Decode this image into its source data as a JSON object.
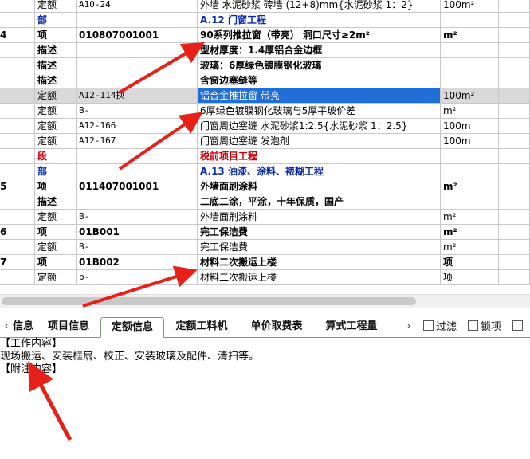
{
  "grid": {
    "rows": [
      {
        "no": "",
        "type": "定额",
        "code": "A10-24",
        "name": "外墙 水泥砂浆 砖墙 (12+8)mm{水泥砂浆 1：2}",
        "unit": "100m²",
        "style": "normal"
      },
      {
        "no": "",
        "type": "部",
        "code": "",
        "name": "A.12 门窗工程",
        "unit": "",
        "style": "blue"
      },
      {
        "no": "4",
        "type": "项",
        "code": "010807001001",
        "name": "90系列推拉窗（带亮） 洞口尺寸≥2m²",
        "unit": "m²",
        "style": "item"
      },
      {
        "no": "",
        "type": "描述",
        "code": "",
        "name": "型材厚度：1.4厚铝合金边框",
        "unit": "",
        "style": "desc"
      },
      {
        "no": "",
        "type": "描述",
        "code": "",
        "name": "玻璃：6厚绿色镀膜钢化玻璃",
        "unit": "",
        "style": "desc"
      },
      {
        "no": "",
        "type": "描述",
        "code": "",
        "name": "含窗边塞缝等",
        "unit": "",
        "style": "desc"
      },
      {
        "no": "",
        "type": "定额",
        "code": "A12-114换",
        "name": "铝合金推拉窗 带亮",
        "unit": "100m²",
        "style": "selected"
      },
      {
        "no": "",
        "type": "定额",
        "code": "B-",
        "name": "6厚绿色镀膜钢化玻璃与5厚平玻价差",
        "unit": "m²",
        "style": "normal"
      },
      {
        "no": "",
        "type": "定额",
        "code": "A12-166",
        "name": "门窗周边塞缝 水泥砂浆1:2.5{水泥砂浆 1：2.5}",
        "unit": "100m",
        "style": "normal"
      },
      {
        "no": "",
        "type": "定额",
        "code": "A12-167",
        "name": "门窗周边塞缝 发泡剂",
        "unit": "100m",
        "style": "normal"
      },
      {
        "no": "",
        "type": "段",
        "code": "",
        "name": "税前项目工程",
        "unit": "",
        "style": "red"
      },
      {
        "no": "",
        "type": "部",
        "code": "",
        "name": "A.13 油漆、涂料、裱糊工程",
        "unit": "",
        "style": "blue"
      },
      {
        "no": "5",
        "type": "项",
        "code": "011407001001",
        "name": "外墙面刷涂料",
        "unit": "m²",
        "style": "item"
      },
      {
        "no": "",
        "type": "描述",
        "code": "",
        "name": "二底二涂，平涂，十年保质，国产",
        "unit": "",
        "style": "desc"
      },
      {
        "no": "",
        "type": "定额",
        "code": "B-",
        "name": "外墙面刷涂料",
        "unit": "m²",
        "style": "normal"
      },
      {
        "no": "6",
        "type": "项",
        "code": "01B001",
        "name": "完工保洁费",
        "unit": "m²",
        "style": "item"
      },
      {
        "no": "",
        "type": "定额",
        "code": "B-",
        "name": "完工保洁费",
        "unit": "m²",
        "style": "normal"
      },
      {
        "no": "7",
        "type": "项",
        "code": "01B002",
        "name": "材料二次搬运上楼",
        "unit": "项",
        "style": "item"
      },
      {
        "no": "",
        "type": "定额",
        "code": "b-",
        "name": "材料二次搬运上楼",
        "unit": "项",
        "style": "normal"
      }
    ]
  },
  "tabs": {
    "prev_icon": "‹",
    "next_icon": "›",
    "items": [
      "信息",
      "项目信息",
      "定额信息",
      "定额工料机",
      "单价取费表",
      "算式工程量"
    ],
    "active": "定额信息"
  },
  "options": {
    "filter_label": "过滤",
    "lock_label": "锁项",
    "third_label": ""
  },
  "detail": {
    "work_content_header": "【工作内容】",
    "work_content": "现场搬运、安装框扇、校正、安装玻璃及配件、清扫等。",
    "additional_header": "【附注内容】"
  },
  "colors": {
    "selection": "#1f6fd6",
    "section_blue": "#0a2aa8",
    "section_red": "#c8000a",
    "arrow_red": "#e8201a"
  }
}
